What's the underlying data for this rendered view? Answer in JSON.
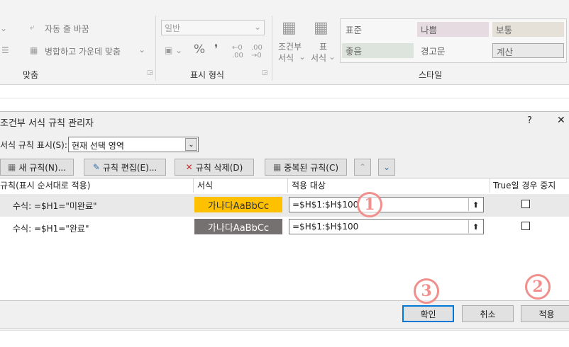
{
  "ribbon": {
    "wrap_text": "자동 줄 바꿈",
    "merge_center": "병합하고 가운데 맞춤",
    "align_group": "맞춤",
    "number_format": "일반",
    "number_group": "표시 형식",
    "cond_format": [
      "조건부",
      "서식"
    ],
    "table_format": [
      "표",
      "서식"
    ],
    "styles": [
      "표준",
      "나쁨",
      "보통",
      "좋음",
      "경고문",
      "계산"
    ],
    "style_group": "스타일"
  },
  "dialog": {
    "title": "조건부 서식 규칙 관리자",
    "help": "?",
    "close": "✕",
    "show_rules_label": "서식 규칙 표시(S):",
    "show_rules_value": "현재 선택 영역",
    "new_rule": "새 규칙(N)...",
    "edit_rule": "규칙 편집(E)...",
    "delete_rule": "규칙 삭제(D)",
    "duplicate_rule": "중복된 규칙(C)",
    "columns": [
      "규칙(표시 순서대로 적용)",
      "서식",
      "적용 대상",
      "True일 경우 중지"
    ],
    "rules": [
      {
        "rule": "수식: =$H1=\"미완료\"",
        "preview": "가나다AaBbCc",
        "preview_bg": "#ffc000",
        "preview_fg": "#333333",
        "applies_to": "=$H$1:$H$100",
        "stop": false
      },
      {
        "rule": "수식: =$H1=\"완료\"",
        "preview": "가나다AaBbCc",
        "preview_bg": "#767171",
        "preview_fg": "#ffffff",
        "applies_to": "=$H$1:$H$100",
        "stop": false
      }
    ],
    "ok": "확인",
    "cancel": "취소",
    "apply": "적용"
  },
  "annotations": [
    "1",
    "2",
    "3"
  ]
}
